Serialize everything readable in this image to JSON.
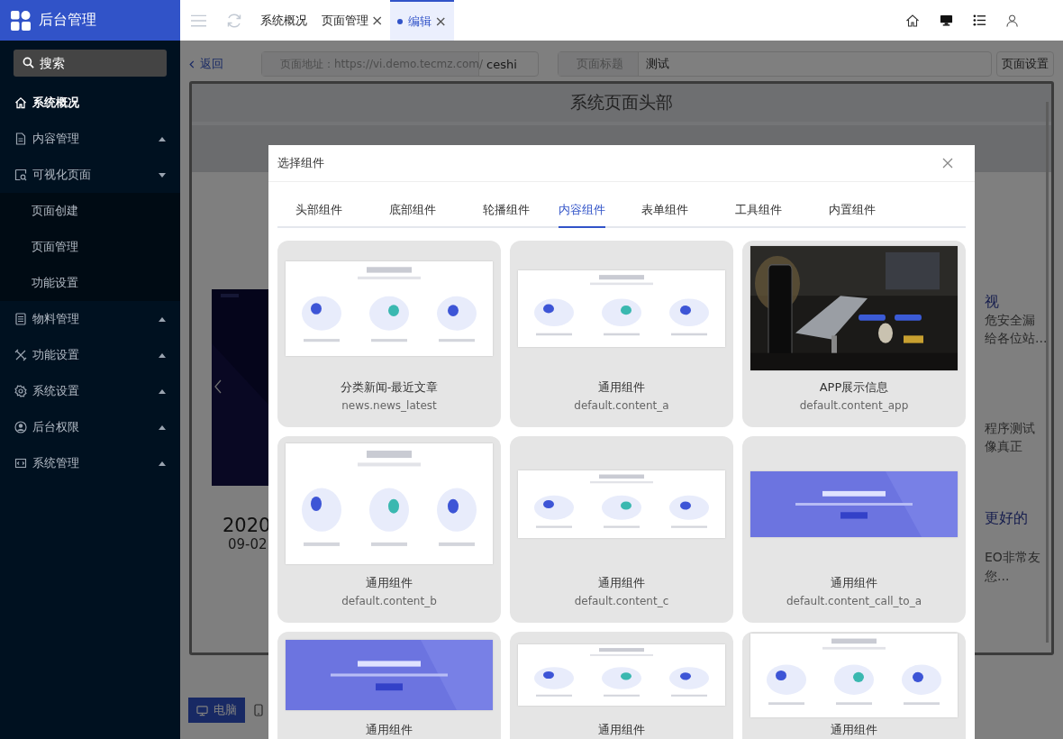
{
  "sidebar": {
    "brand": "后台管理",
    "search": {
      "placeholder": "搜索"
    },
    "items": [
      {
        "label": "系统概况",
        "selected": true
      },
      {
        "label": "内容管理",
        "selected": false,
        "expanded": false
      },
      {
        "label": "可视化页面",
        "selected": false,
        "expanded": true,
        "children": [
          {
            "label": "页面创建",
            "selected": false
          },
          {
            "label": "页面管理",
            "selected": false
          },
          {
            "label": "功能设置",
            "selected": false
          }
        ]
      },
      {
        "label": "物料管理",
        "selected": false,
        "expanded": false
      },
      {
        "label": "功能设置",
        "selected": false,
        "expanded": false
      },
      {
        "label": "系统设置",
        "selected": false,
        "expanded": false
      },
      {
        "label": "后台权限",
        "selected": false,
        "expanded": false
      },
      {
        "label": "系统管理",
        "selected": false,
        "expanded": false
      }
    ]
  },
  "tabs": [
    {
      "label": "系统概况",
      "selected": false
    },
    {
      "label": "页面管理",
      "close": "×",
      "selected": false
    },
    {
      "label": "编辑",
      "close": "×",
      "selected": true
    }
  ],
  "toolbar": {
    "back": "返回",
    "url_label": "页面地址：https://vi.demo.tecmz.com/",
    "url_value": "ceshi",
    "title_label": "页面标题",
    "title_value": "测试",
    "settings_button": "页面设置"
  },
  "canvas": {
    "header": "系统页面头部",
    "year": "2020",
    "date": "09-02",
    "side_texts": [
      {
        "text": "视",
        "kind": "heading"
      },
      {
        "text": "危安全漏",
        "kind": "body"
      },
      {
        "text": "给各位站...",
        "kind": "body"
      },
      {
        "text": "程序测试",
        "kind": "body"
      },
      {
        "text": "像真正",
        "kind": "body"
      },
      {
        "text": "更好的",
        "kind": "heading"
      },
      {
        "text": "EO非常友",
        "kind": "body"
      },
      {
        "text": "您...",
        "kind": "body"
      }
    ]
  },
  "devices": [
    {
      "label": "电脑",
      "selected": true
    }
  ],
  "dialog": {
    "title": "选择组件",
    "tabs": [
      {
        "label": "头部组件",
        "selected": false
      },
      {
        "label": "底部组件",
        "selected": false
      },
      {
        "label": "轮播组件",
        "selected": false
      },
      {
        "label": "内容组件",
        "selected": true
      },
      {
        "label": "表单组件",
        "selected": false
      },
      {
        "label": "工具组件",
        "selected": false
      },
      {
        "label": "内置组件",
        "selected": false
      }
    ],
    "components": [
      {
        "title": "分类新闻-最近文章",
        "code": "news.news_latest"
      },
      {
        "title": "通用组件",
        "code": "default.content_a"
      },
      {
        "title": "APP展示信息",
        "code": "default.content_app"
      },
      {
        "title": "通用组件",
        "code": "default.content_b"
      },
      {
        "title": "通用组件",
        "code": "default.content_c"
      },
      {
        "title": "通用组件",
        "code": "default.content_call_to_a"
      },
      {
        "title": "通用组件"
      },
      {
        "title": "通用组件"
      },
      {
        "title": "通用组件"
      }
    ]
  }
}
